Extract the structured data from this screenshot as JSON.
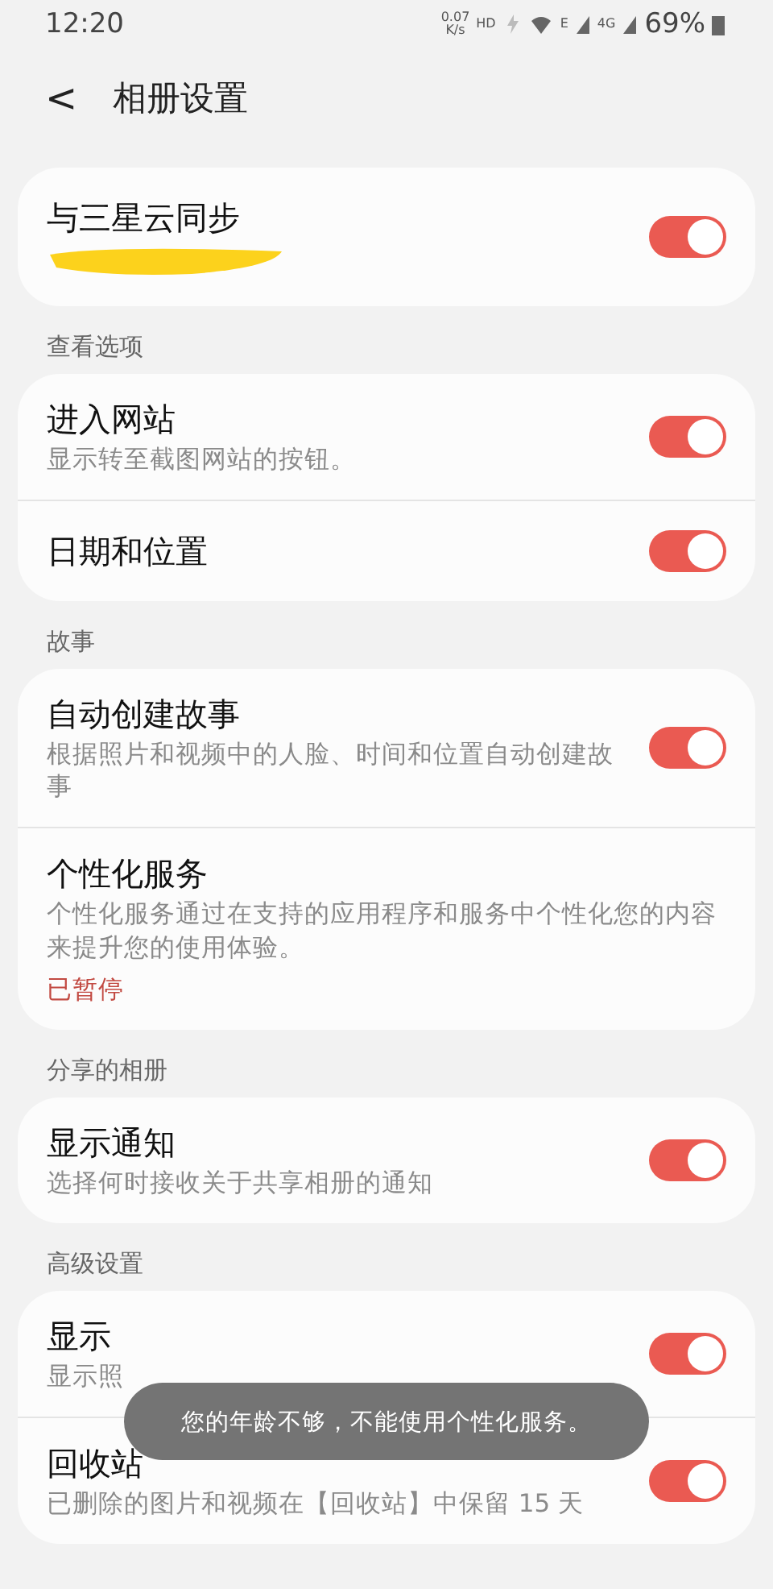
{
  "status_bar": {
    "time": "12:20",
    "speed_value": "0.07",
    "speed_unit": "K/s",
    "hd": "HD",
    "network_e": "E",
    "network_4g": "4G",
    "battery": "69%"
  },
  "header": {
    "back": "<",
    "title": "相册设置"
  },
  "groups": [
    {
      "rows": [
        {
          "title": "与三星云同步",
          "redacted": true,
          "on": true
        }
      ]
    },
    {
      "heading": "查看选项",
      "rows": [
        {
          "title": "进入网站",
          "subtitle": "显示转至截图网站的按钮。",
          "on": true
        },
        {
          "title": "日期和位置",
          "on": true
        }
      ]
    },
    {
      "heading": "故事",
      "rows": [
        {
          "title": "自动创建故事",
          "subtitle": "根据照片和视频中的人脸、时间和位置自动创建故事",
          "on": true
        },
        {
          "title": "个性化服务",
          "subtitle": "个性化服务通过在支持的应用程序和服务中个性化您的内容来提升您的使用体验。",
          "status": "已暂停"
        }
      ]
    },
    {
      "heading": "分享的相册",
      "rows": [
        {
          "title": "显示通知",
          "subtitle": "选择何时接收关于共享相册的通知",
          "on": true
        }
      ]
    },
    {
      "heading": "高级设置",
      "rows": [
        {
          "title": "显示",
          "subtitle": "显示照",
          "on": true
        },
        {
          "title": "回收站",
          "subtitle": "已删除的图片和视频在【回收站】中保留 15 天",
          "on": true
        }
      ]
    }
  ],
  "toast": "您的年龄不够，不能使用个性化服务。"
}
